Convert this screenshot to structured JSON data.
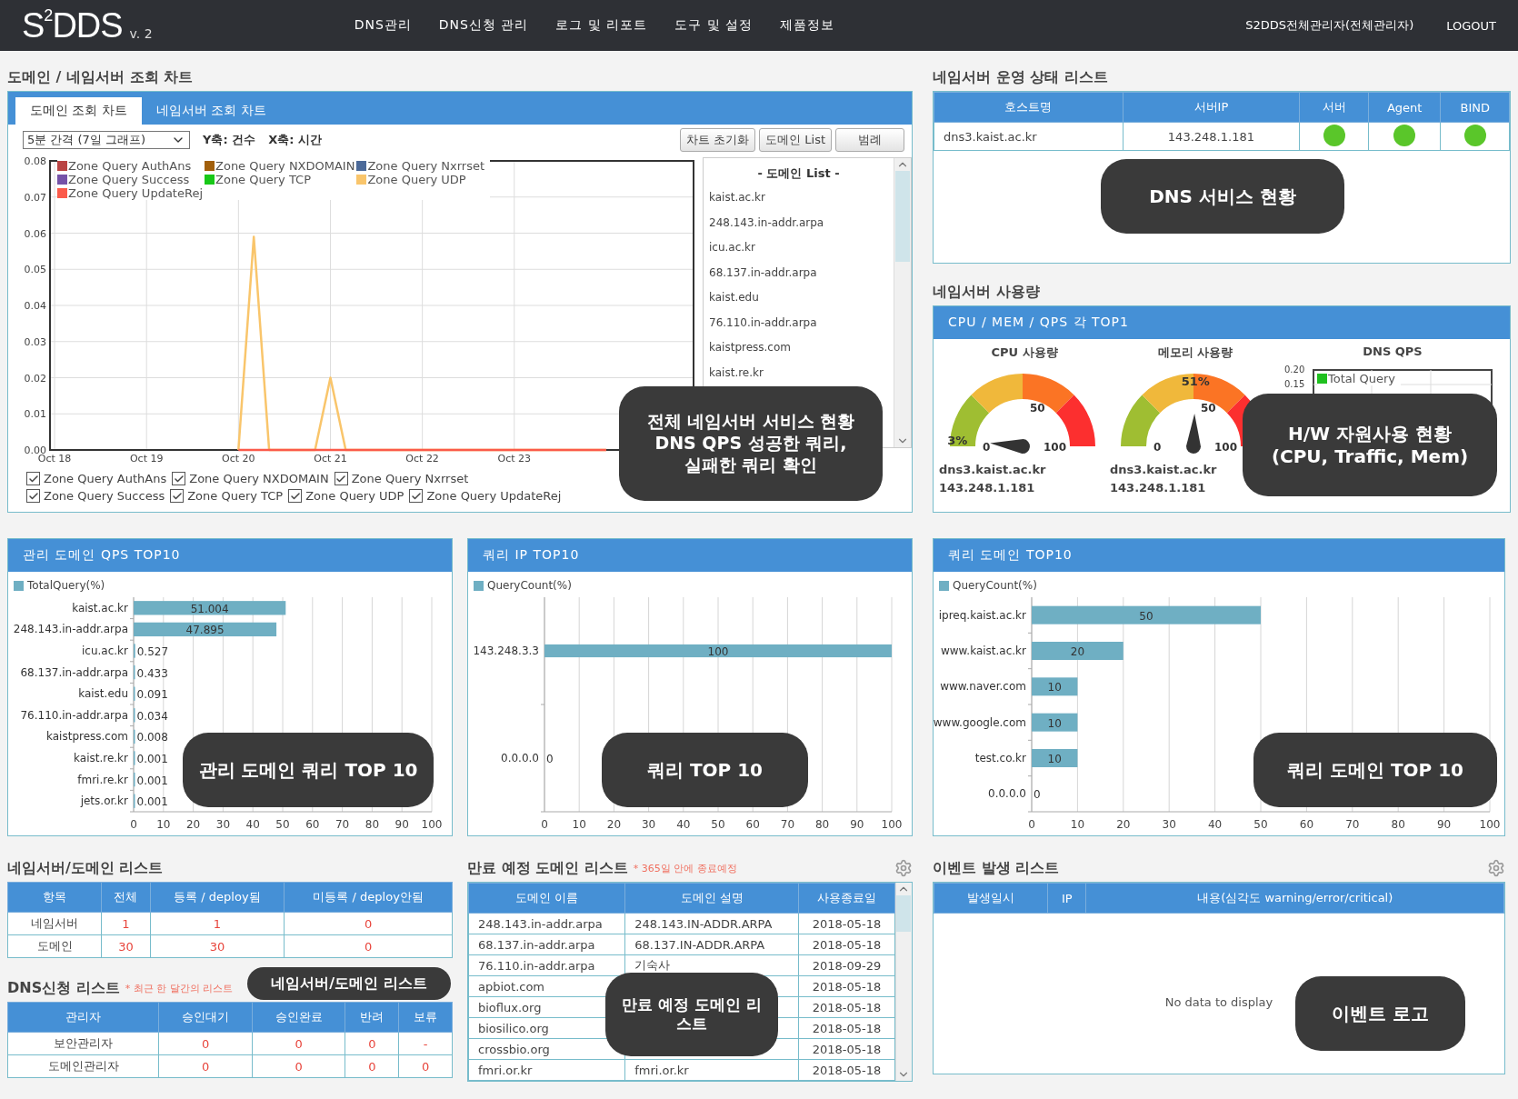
{
  "header": {
    "logo": "S$^{2}$DDS",
    "version": "v. 2",
    "menu": [
      "DNS관리",
      "DNS신청 관리",
      "로그 및 리포트",
      "도구 및 설정",
      "제품정보"
    ],
    "user": "S2DDS전체관리자(전체관리자)",
    "logout": "LOGOUT"
  },
  "query_chart": {
    "title": "도메인 / 네임서버 조회 차트",
    "tabs": [
      {
        "label": "도메인 조회 차트",
        "selected": true
      },
      {
        "label": "네임서버 조회 차트",
        "selected": false
      }
    ],
    "interval": "5분 간격 (7일 그래프)",
    "axis_notes": [
      "Y축: 건수",
      "X축: 시간"
    ],
    "buttons": [
      "차트 초기화",
      "도메인 List",
      "범례"
    ],
    "chart_data": {
      "type": "line",
      "grid": true,
      "ylim": [
        0,
        0.08
      ],
      "categories": [
        "Oct 18",
        null,
        null,
        null,
        null,
        null,
        "Oct 19",
        null,
        null,
        null,
        null,
        null,
        "Oct 20",
        null,
        null,
        null,
        null,
        null,
        "Oct 21",
        null,
        null,
        null,
        null,
        null,
        "Oct 22",
        null,
        null,
        null,
        null,
        null,
        "Oct 23",
        null,
        null,
        null,
        null,
        null,
        null,
        null,
        null,
        null,
        null,
        null
      ],
      "yticks": [
        {
          "value": 0,
          "label": "0.00"
        },
        {
          "value": 0.01,
          "label": "0.01"
        },
        {
          "value": 0.02,
          "label": "0.02"
        },
        {
          "value": 0.03,
          "label": "0.03"
        },
        {
          "value": 0.04,
          "label": "0.04"
        },
        {
          "value": 0.05,
          "label": "0.05"
        },
        {
          "value": 0.06,
          "label": "0.06"
        },
        {
          "value": 0.07,
          "label": "0.07"
        },
        {
          "value": 0.08,
          "label": "0.08"
        }
      ],
      "series": [
        {
          "name": "Zone Query AuthAns",
          "color": "#b94343",
          "values": [
            null,
            null,
            null,
            null,
            null,
            null,
            null,
            null,
            null,
            null,
            null,
            null,
            null,
            null,
            null,
            null,
            null,
            null,
            null,
            null,
            null,
            null,
            null,
            null,
            null,
            null,
            null,
            null,
            null,
            null,
            null,
            null,
            null,
            null,
            null,
            null,
            null,
            null,
            null,
            null,
            null,
            null
          ]
        },
        {
          "name": "Zone Query NXDOMAIN",
          "color": "#a15f0c",
          "values": [
            null,
            null,
            null,
            null,
            null,
            null,
            null,
            null,
            null,
            null,
            null,
            null,
            null,
            null,
            null,
            null,
            null,
            null,
            null,
            null,
            null,
            null,
            null,
            null,
            null,
            null,
            null,
            null,
            null,
            null,
            null,
            null,
            null,
            null,
            null,
            null,
            null,
            null,
            null,
            null,
            null,
            null
          ]
        },
        {
          "name": "Zone Query Nxrrset",
          "color": "#4c6a99",
          "values": [
            null,
            null,
            null,
            null,
            null,
            null,
            null,
            null,
            null,
            null,
            null,
            null,
            null,
            null,
            null,
            null,
            null,
            null,
            null,
            null,
            null,
            null,
            null,
            null,
            null,
            null,
            null,
            null,
            null,
            null,
            null,
            null,
            null,
            null,
            null,
            null,
            null,
            null,
            null,
            null,
            null,
            null
          ]
        },
        {
          "name": "Zone Query Success",
          "color": "#7552a8",
          "values": [
            null,
            null,
            null,
            null,
            null,
            null,
            null,
            null,
            null,
            null,
            null,
            null,
            null,
            null,
            null,
            null,
            null,
            null,
            null,
            null,
            null,
            null,
            null,
            null,
            null,
            null,
            null,
            null,
            null,
            null,
            null,
            null,
            null,
            null,
            null,
            null,
            null,
            null,
            null,
            null,
            null,
            null
          ]
        },
        {
          "name": "Zone Query TCP",
          "color": "#18c818",
          "values": [
            null,
            null,
            null,
            null,
            null,
            null,
            null,
            null,
            null,
            null,
            null,
            null,
            null,
            null,
            null,
            null,
            null,
            null,
            null,
            null,
            null,
            null,
            null,
            null,
            null,
            null,
            null,
            null,
            null,
            null,
            null,
            null,
            null,
            null,
            null,
            null,
            null,
            null,
            null,
            null,
            null,
            null
          ]
        },
        {
          "name": "Zone Query UDP",
          "color": "#f9c56b",
          "values": [
            null,
            null,
            null,
            null,
            null,
            null,
            null,
            null,
            null,
            null,
            null,
            null,
            0,
            0.059,
            0,
            0,
            0,
            0,
            0.02,
            0,
            0,
            0,
            0,
            0,
            0,
            0,
            0,
            0,
            0,
            0,
            0,
            0,
            0,
            0,
            0,
            0,
            0,
            null,
            null,
            null,
            null,
            null
          ]
        },
        {
          "name": "Zone Query UpdateRej",
          "color": "#fb5a4a",
          "values": [
            null,
            null,
            null,
            null,
            null,
            null,
            null,
            null,
            null,
            null,
            null,
            null,
            0,
            0,
            0,
            0,
            0,
            0,
            0,
            0,
            0,
            0,
            0,
            0,
            0,
            0,
            0,
            0,
            0,
            0,
            0,
            0,
            0,
            0,
            0,
            0,
            0,
            null,
            null,
            null,
            null,
            null
          ]
        }
      ]
    },
    "domain_list": {
      "title": "- 도메인 List -",
      "items": [
        "kaist.ac.kr",
        "248.143.in-addr.arpa",
        "icu.ac.kr",
        "68.137.in-addr.arpa",
        "kaist.edu",
        "76.110.in-addr.arpa",
        "kaistpress.com",
        "kaist.re.kr"
      ]
    },
    "series_toggles": [
      {
        "label": "Zone Query AuthAns",
        "checked": true
      },
      {
        "label": "Zone Query NXDOMAIN",
        "checked": true
      },
      {
        "label": "Zone Query Nxrrset",
        "checked": true
      },
      {
        "label": "Zone Query Success",
        "checked": true
      },
      {
        "label": "Zone Query TCP",
        "checked": true
      },
      {
        "label": "Zone Query UDP",
        "checked": true
      },
      {
        "label": "Zone Query UpdateRej",
        "checked": true
      }
    ],
    "callout": "전체 네임서버 서비스 현황\nDNS QPS 성공한 쿼리,\n실패한 쿼리 확인"
  },
  "ns_status": {
    "title": "네임서버 운영 상태 리스트",
    "columns": [
      "호스트명",
      "서버IP",
      "서버",
      "Agent",
      "BIND"
    ],
    "rows": [
      {
        "host": "dns3.kaist.ac.kr",
        "ip": "143.248.1.181",
        "server_on": true,
        "agent_on": true,
        "bind_on": true
      }
    ],
    "callout": "DNS 서비스 현황"
  },
  "ns_usage": {
    "title": "네임서버 사용량",
    "header": "CPU / MEM / QPS 각 TOP1",
    "gauges": [
      {
        "title": "CPU 사용량",
        "level": 0.03,
        "reading": "3%",
        "ticks": [
          "0",
          "50",
          "100"
        ],
        "host": "dns3.kaist.ac.kr",
        "ip": "143.248.1.181"
      },
      {
        "title": "메모리 사용량",
        "level": 0.51,
        "reading": "51%",
        "ticks": [
          "0",
          "50",
          "100"
        ],
        "host": "dns3.kaist.ac.kr",
        "ip": "143.248.1.181"
      }
    ],
    "qps": {
      "title": "DNS QPS",
      "y_labels": [
        "0.20",
        "0.15"
      ],
      "legend": "Total Query"
    },
    "callout": "H/W 자원사용 현황\n(CPU, Traffic, Mem)"
  },
  "top_charts": [
    {
      "title": "관리 도메인 QPS TOP10",
      "callout": "관리 도메인 쿼리 TOP 10",
      "chart_data": {
        "type": "bar",
        "orientation": "horizontal",
        "grid": true,
        "data_labels": true,
        "xlim": [
          0,
          100
        ],
        "xticks": [
          0,
          10,
          20,
          30,
          40,
          50,
          60,
          70,
          80,
          90,
          100
        ],
        "categories": [
          "kaist.ac.kr",
          "248.143.in-addr.arpa",
          "icu.ac.kr",
          "68.137.in-addr.arpa",
          "kaist.edu",
          "76.110.in-addr.arpa",
          "kaistpress.com",
          "kaist.re.kr",
          "fmri.re.kr",
          "jets.or.kr"
        ],
        "series": [
          {
            "name": "TotalQuery(%)",
            "color": "#6fafc3",
            "values": [
              51.004,
              47.895,
              0.527,
              0.433,
              0.091,
              0.034,
              0.008,
              0.001,
              0.001,
              0.001
            ]
          }
        ]
      }
    },
    {
      "title": "쿼리 IP TOP10",
      "callout": "쿼리 TOP 10",
      "chart_data": {
        "type": "bar",
        "orientation": "horizontal",
        "grid": true,
        "data_labels": true,
        "xlim": [
          0,
          100
        ],
        "xticks": [
          0,
          10,
          20,
          30,
          40,
          50,
          60,
          70,
          80,
          90,
          100
        ],
        "categories": [
          "143.248.3.3",
          "0.0.0.0"
        ],
        "series": [
          {
            "name": "QueryCount(%)",
            "color": "#6fafc3",
            "values": [
              100,
              0
            ]
          }
        ]
      }
    },
    {
      "title": "쿼리 도메인 TOP10",
      "callout": "쿼리 도메인 TOP 10",
      "chart_data": {
        "type": "bar",
        "orientation": "horizontal",
        "grid": true,
        "data_labels": true,
        "xlim": [
          0,
          100
        ],
        "xticks": [
          0,
          10,
          20,
          30,
          40,
          50,
          60,
          70,
          80,
          90,
          100
        ],
        "categories": [
          "ipreq.kaist.ac.kr",
          "www.kaist.ac.kr",
          "www.naver.com",
          "www.google.com",
          "test.co.kr",
          "0.0.0.0"
        ],
        "series": [
          {
            "name": "QueryCount(%)",
            "color": "#6fafc3",
            "values": [
              50,
              20,
              10,
              10,
              10,
              0
            ]
          }
        ]
      }
    }
  ],
  "ns_domain_list": {
    "title": "네임서버/도메인 리스트",
    "columns": [
      "항목",
      "전체",
      "등록 / deploy됨",
      "미등록 / deploy안됨"
    ],
    "rows": [
      [
        "네임서버",
        "1",
        "1",
        "0"
      ],
      [
        "도메인",
        "30",
        "30",
        "0"
      ]
    ],
    "callout": "네임서버/도메인 리스트"
  },
  "dns_requests": {
    "title": "DNS신청 리스트",
    "note": "* 최근 한 달간의 리스트",
    "columns": [
      "관리자",
      "승인대기",
      "승인완료",
      "반려",
      "보류"
    ],
    "rows": [
      [
        "보안관리자",
        "0",
        "0",
        "0",
        "-"
      ],
      [
        "도메인관리자",
        "0",
        "0",
        "0",
        "0"
      ]
    ]
  },
  "expiring": {
    "title": "만료 예정 도메인 리스트",
    "note": "* 365일 안에 종료예정",
    "columns": [
      "도메인 이름",
      "도메인 설명",
      "사용종료일"
    ],
    "rows": [
      [
        "248.143.in-addr.arpa",
        "248.143.IN-ADDR.ARPA",
        "2018-05-18"
      ],
      [
        "68.137.in-addr.arpa",
        "68.137.IN-ADDR.ARPA",
        "2018-05-18"
      ],
      [
        "76.110.in-addr.arpa",
        "기숙사",
        "2018-09-29"
      ],
      [
        "apbiot.com",
        null,
        "2018-05-18"
      ],
      [
        "bioflux.org",
        null,
        "2018-05-18"
      ],
      [
        "biosilico.org",
        null,
        "2018-05-18"
      ],
      [
        "crossbio.org",
        null,
        "2018-05-18"
      ],
      [
        "fmri.or.kr",
        "fmri.or.kr",
        "2018-05-18"
      ]
    ],
    "callout": "만료 예정 도메인 리스트"
  },
  "events": {
    "title": "이벤트 발생 리스트",
    "columns": [
      "발생일시",
      "IP",
      "내용(심각도 warning/error/critical)"
    ],
    "empty": "No data to display",
    "callout": "이벤트 로고"
  }
}
